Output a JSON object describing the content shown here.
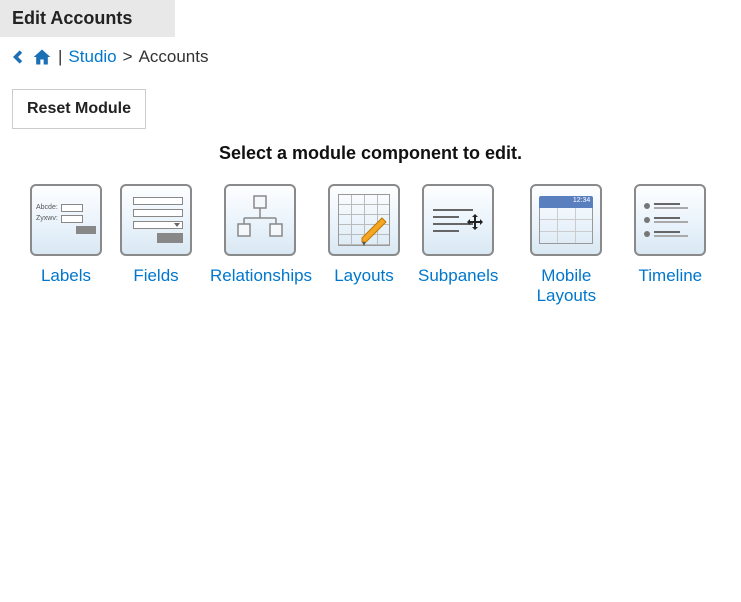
{
  "header": {
    "title": "Edit Accounts"
  },
  "breadcrumb": {
    "separator_pipe": "|",
    "studio_link": "Studio",
    "gt": ">",
    "current": "Accounts"
  },
  "actions": {
    "reset_module": "Reset Module"
  },
  "section": {
    "prompt": "Select a module component to edit."
  },
  "tiles": {
    "labels": "Labels",
    "fields": "Fields",
    "relationships": "Relationships",
    "layouts": "Layouts",
    "subpanels": "Subpanels",
    "mobile_layouts": "Mobile Layouts",
    "timeline": "Timeline"
  },
  "labels_icon": {
    "row1": "Abcde:",
    "row2": "Zyxwv:"
  }
}
